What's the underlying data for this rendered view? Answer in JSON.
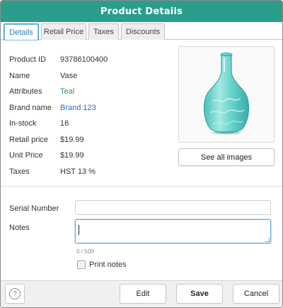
{
  "window": {
    "title": "Product Details"
  },
  "tabs": [
    {
      "label": "Details",
      "active": true
    },
    {
      "label": "Retail Price",
      "active": false
    },
    {
      "label": "Taxes",
      "active": false
    },
    {
      "label": "Discounts",
      "active": false
    }
  ],
  "details": [
    {
      "label": "Product ID",
      "value": "93786100400"
    },
    {
      "label": "Name",
      "value": "Vase"
    },
    {
      "label": "Attributes",
      "value": "Teal"
    },
    {
      "label": "Brand name",
      "value": "Brand 123"
    },
    {
      "label": "In-stock",
      "value": "16"
    },
    {
      "label": "Retail price",
      "value": "$19.99"
    },
    {
      "label": "Unit Price",
      "value": "$19.99"
    },
    {
      "label": "Taxes",
      "value": "HST 13 %"
    }
  ],
  "image": {
    "icon": "vase-image",
    "see_all_label": "See all images"
  },
  "form": {
    "serial_label": "Serial Number",
    "serial_value": "",
    "notes_label": "Notes",
    "notes_value": "",
    "notes_counter": "0 / 500",
    "print_notes_label": "Print notes",
    "print_notes_checked": false
  },
  "footer": {
    "help_icon": "question-circle-icon",
    "help_glyph": "?",
    "edit_label": "Edit",
    "save_label": "Save",
    "cancel_label": "Cancel"
  },
  "colors": {
    "titlebar": "#2a9e8c",
    "active_tab": "#2f7fb5",
    "attribute_green": "#2e9c4a",
    "link_blue": "#2f73b5"
  }
}
